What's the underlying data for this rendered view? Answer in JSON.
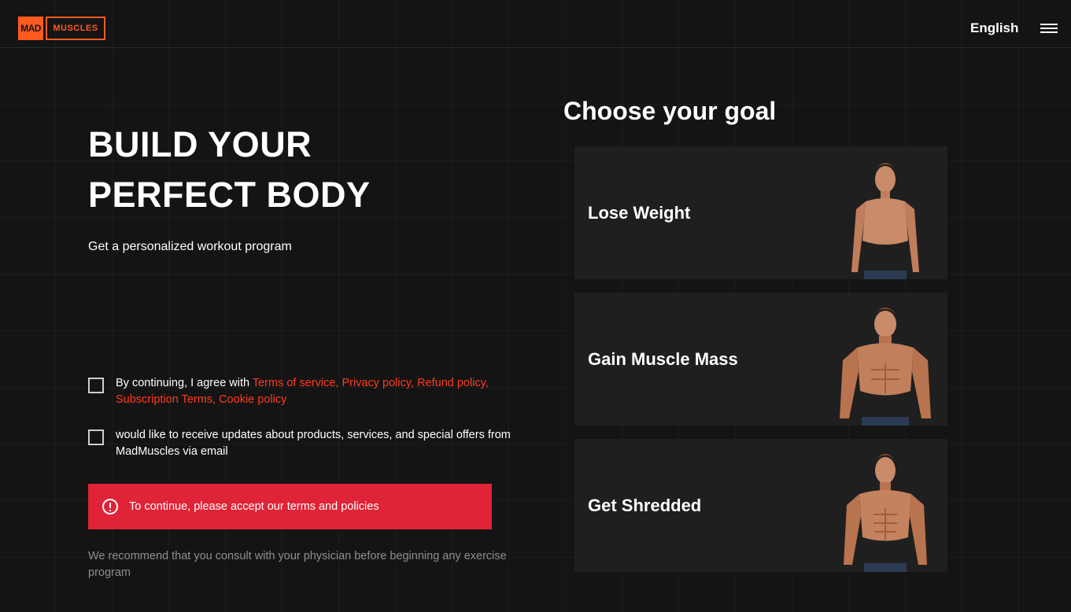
{
  "brand": {
    "logo_mad": "MAD",
    "logo_muscles": "MUSCLES",
    "accent": "#ff5a1f"
  },
  "header": {
    "language": "English",
    "menu_icon": "hamburger-menu-icon"
  },
  "hero": {
    "title_line1": "BUILD YOUR",
    "title_line2": "PERFECT BODY",
    "subtitle": "Get a personalized workout program"
  },
  "consent": {
    "terms_prefix": "By continuing, I agree with ",
    "terms_links": "Terms of service, Privacy policy, Refund policy, Subscription Terms, Cookie policy",
    "updates_text": "would like to receive updates about products, services, and special offers from MadMuscles via email"
  },
  "error": {
    "icon": "alert-circle-icon",
    "message": "To continue, please accept our terms and policies",
    "color": "#e02336"
  },
  "disclaimer": "We recommend that you consult with your physician before beginning any exercise program",
  "goals": {
    "title": "Choose your goal",
    "items": [
      {
        "label": "Lose Weight"
      },
      {
        "label": "Gain Muscle Mass"
      },
      {
        "label": "Get Shredded"
      }
    ]
  }
}
